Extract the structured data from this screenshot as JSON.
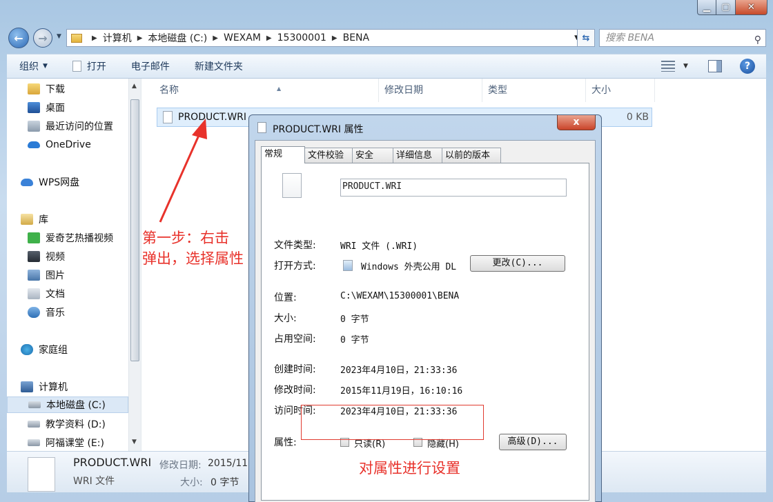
{
  "window": {
    "min_icon": "minimize-icon",
    "max_icon": "maximize-icon",
    "close_icon": "close-icon"
  },
  "address": {
    "crumbs": [
      "计算机",
      "本地磁盘 (C:)",
      "WEXAM",
      "15300001",
      "BENA"
    ],
    "search_placeholder": "搜索 BENA"
  },
  "toolbar": {
    "organize": "组织",
    "open": "打开",
    "email": "电子邮件",
    "new_folder": "新建文件夹"
  },
  "nav": {
    "items": [
      "下载",
      "桌面",
      "最近访问的位置",
      "OneDrive",
      "WPS网盘",
      "库",
      "爱奇艺热播视频",
      "视频",
      "图片",
      "文档",
      "音乐",
      "家庭组",
      "计算机",
      "本地磁盘 (C:)",
      "教学资料 (D:)",
      "阿福课堂 (E:)"
    ]
  },
  "columns": {
    "name": "名称",
    "modified": "修改日期",
    "type": "类型",
    "size": "大小"
  },
  "file": {
    "name": "PRODUCT.WRI",
    "size": "0 KB"
  },
  "details": {
    "name": "PRODUCT.WRI",
    "type": "WRI 文件",
    "modified_label": "修改日期:",
    "modified_value": "2015/11",
    "size_label": "大小:",
    "size_value": "0 字节"
  },
  "annotations": {
    "step1_line1": "第一步：右击",
    "step1_line2": "弹出，选择属性",
    "step2": "对属性进行设置",
    "color": "#e8322b"
  },
  "dialog": {
    "title": "PRODUCT.WRI 属性",
    "close": "x",
    "tabs": [
      "常规",
      "文件校验",
      "安全",
      "详细信息",
      "以前的版本"
    ],
    "filename": "PRODUCT.WRI",
    "type_label": "文件类型:",
    "type_value": "WRI 文件 (.WRI)",
    "open_label": "打开方式:",
    "open_value": "Windows 外壳公用 DL",
    "change_btn": "更改(C)...",
    "location_label": "位置:",
    "location_value": "C:\\WEXAM\\15300001\\BENA",
    "size_label": "大小:",
    "size_value": "0 字节",
    "disk_label": "占用空间:",
    "disk_value": "0 字节",
    "created_label": "创建时间:",
    "created_value": "2023年4月10日，21:33:36",
    "modified_label": "修改时间:",
    "modified_value": "2015年11月19日，16:10:16",
    "accessed_label": "访问时间:",
    "accessed_value": "2023年4月10日，21:33:36",
    "attr_label": "属性:",
    "readonly": "只读(R)",
    "hidden": "隐藏(H)",
    "advanced_btn": "高级(D)..."
  }
}
